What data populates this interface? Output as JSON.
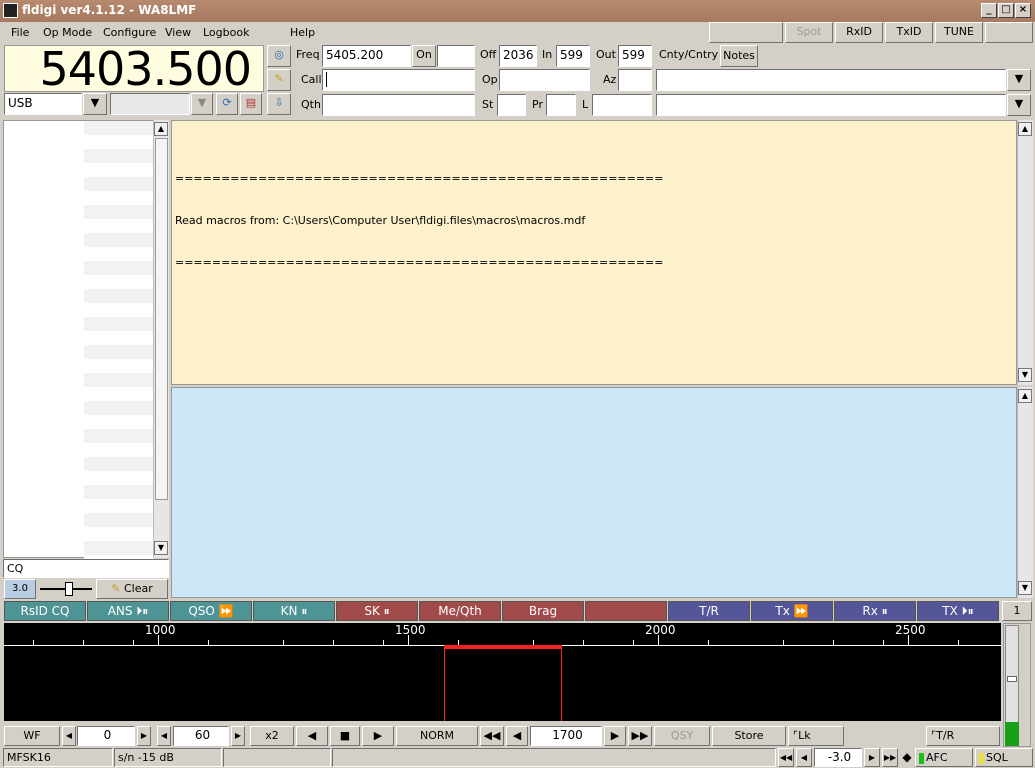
{
  "window": {
    "title": "fldigi ver4.1.12 - WA8LMF",
    "minimize": "_",
    "maximize": "□",
    "close": "×"
  },
  "menu": {
    "items": [
      "File",
      "Op Mode",
      "Configure",
      "View",
      "Logbook",
      "Help"
    ]
  },
  "toolbar_right": {
    "spot": "Spot",
    "rxid": "RxID",
    "txid": "TxID",
    "tune": "TUNE"
  },
  "frequency": {
    "display": "5403.500",
    "mode": "USB"
  },
  "log": {
    "freq_label": "Freq",
    "freq_value": "5405.200",
    "on_label": "On",
    "on_value": "",
    "off_label": "Off",
    "off_value": "2036",
    "in_label": "In",
    "in_value": "599",
    "out_label": "Out",
    "out_value": "599",
    "cnty_label": "Cnty/Cntry",
    "notes_label": "Notes",
    "call_label": "Call",
    "call_value": "",
    "op_label": "Op",
    "op_value": "",
    "az_label": "Az",
    "az_value": "",
    "qth_label": "Qth",
    "qth_value": "",
    "st_label": "St",
    "st_value": "",
    "pr_label": "Pr",
    "pr_value": "",
    "l_label": "L",
    "l_value": ""
  },
  "rx_text": {
    "line1": "=====================================================",
    "line2": "Read macros from: C:\\Users\\Computer User\\fldigi.files\\macros\\macros.mdf",
    "line3": "====================================================="
  },
  "left_panel": {
    "cq_value": "CQ",
    "squelch_value": "3.0",
    "clear_label": "Clear"
  },
  "macros": {
    "items": [
      "RsID CQ",
      "ANS ⏵⏸",
      "QSO ⏩",
      "KN ⏸",
      "SK ⏸",
      "Me/Qth",
      "Brag",
      "",
      "T/R",
      "Tx ⏩",
      "Rx ⏸",
      "TX ⏵⏸"
    ],
    "bank": "1"
  },
  "waterfall": {
    "scale_labels": [
      "1000",
      "1500",
      "2000",
      "2500"
    ],
    "colors": {
      "background": "#000000",
      "marker": "#ff2020",
      "signal_level": "#18a018"
    }
  },
  "wf_controls": {
    "wf_label": "WF",
    "offset_value": "0",
    "rate_value": "60",
    "zoom_label": "x2",
    "norm_label": "NORM",
    "carrier_value": "1700",
    "qsy_label": "QSY",
    "store_label": "Store",
    "lk_label": "Lk",
    "tr_label": "T/R"
  },
  "status": {
    "mode": "MFSK16",
    "snr": "s/n -15 dB",
    "afc_value": "-3.0",
    "afc_label": "AFC",
    "sql_label": "SQL"
  }
}
